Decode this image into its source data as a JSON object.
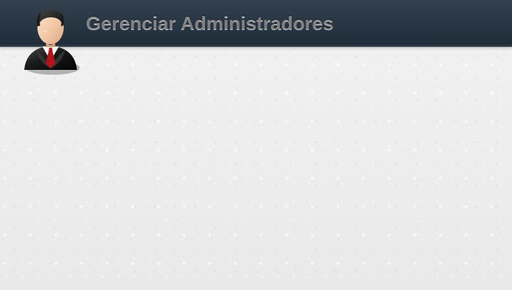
{
  "header": {
    "title": "Gerenciar Administradores"
  },
  "avatar": {
    "icon": "business-user-icon"
  },
  "colors": {
    "header_top": "#33414f",
    "header_bottom": "#1f2b37",
    "title_text": "#d9dde1",
    "page_background": "#ececec",
    "tie": "#b1141b",
    "skin": "#f2c7a3"
  }
}
